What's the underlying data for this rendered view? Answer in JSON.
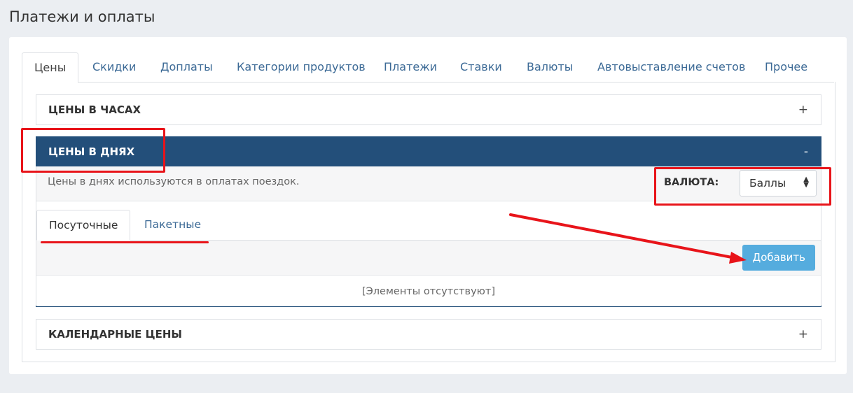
{
  "page": {
    "title": "Платежи и оплаты"
  },
  "tabs": [
    {
      "label": "Цены"
    },
    {
      "label": "Скидки"
    },
    {
      "label": "Доплаты"
    },
    {
      "label": "Категории продуктов"
    },
    {
      "label": "Платежи"
    },
    {
      "label": "Ставки"
    },
    {
      "label": "Валюты"
    },
    {
      "label": "Автовыставление счетов"
    },
    {
      "label": "Прочее"
    }
  ],
  "panels": {
    "hours": {
      "title": "ЦЕНЫ В ЧАСАХ",
      "toggle": "+"
    },
    "days": {
      "title": "ЦЕНЫ В ДНЯХ",
      "toggle": "-",
      "info": "Цены в днях используются в оплатах поездок.",
      "currency_label": "ВАЛЮТА:",
      "currency_value": "Баллы",
      "subtabs": [
        {
          "label": "Посуточные"
        },
        {
          "label": "Пакетные"
        }
      ],
      "add_label": "Добавить",
      "empty_text": "[Элементы отсутствуют]"
    },
    "calendar": {
      "title": "КАЛЕНДАРНЫЕ ЦЕНЫ",
      "toggle": "+"
    }
  },
  "colors": {
    "accent": "#234f7a",
    "link": "#3c6a96",
    "button": "#55acde",
    "annotation": "#e8141a"
  }
}
